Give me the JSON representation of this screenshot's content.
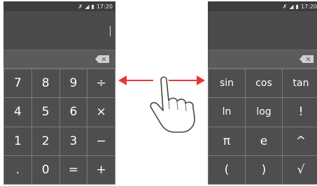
{
  "status_bar": {
    "icons": [
      "bluetooth-icon",
      "signal-icon",
      "battery-icon"
    ],
    "time": "17:20"
  },
  "left": {
    "delete_icon": "backspace-icon",
    "keys": [
      "7",
      "8",
      "9",
      "÷",
      "4",
      "5",
      "6",
      "×",
      "1",
      "2",
      "3",
      "−",
      ".",
      "0",
      "=",
      "+"
    ]
  },
  "right": {
    "delete_icon": "backspace-icon",
    "keys": [
      "sin",
      "cos",
      "tan",
      "ln",
      "log",
      "!",
      "π",
      "e",
      "^",
      "(",
      ")",
      "√"
    ]
  },
  "gesture": {
    "icon": "swipe-hand-icon",
    "arrow_color": "#e53935",
    "directions": [
      "left",
      "right"
    ]
  },
  "colors": {
    "display": "#4b4b4b",
    "key": "#4e4e4e",
    "key_gap": "#7a7a7a",
    "status_bar": "#3d3d3d"
  }
}
